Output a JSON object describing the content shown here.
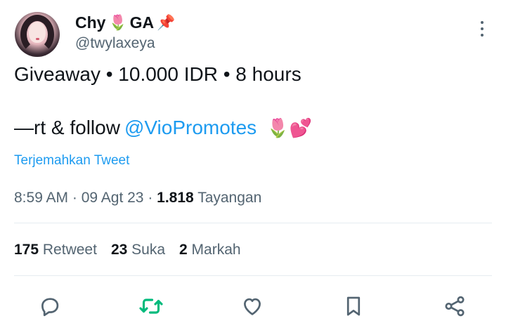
{
  "author": {
    "display_name": "Chy",
    "name_suffix": "GA",
    "emoji_1": "🌷",
    "emoji_2": "📌",
    "handle": "@twylaxeya"
  },
  "tweet": {
    "line1": "Giveaway • 10.000 IDR • 8 hours",
    "line2_prefix": "—rt & follow",
    "mention": "@VioPromotes",
    "line2_emoji": "🌷💕",
    "translate_link": "Terjemahkan Tweet"
  },
  "meta": {
    "time": "8:59 AM",
    "date": "09 Agt 23",
    "views_count": "1.818",
    "views_label": "Tayangan"
  },
  "stats": {
    "retweets_count": "175",
    "retweets_label": "Retweet",
    "likes_count": "23",
    "likes_label": "Suka",
    "bookmarks_count": "2",
    "bookmarks_label": "Markah"
  },
  "actions": {
    "reply_icon": "reply-icon",
    "retweet_icon": "retweet-icon",
    "like_icon": "heart-icon",
    "bookmark_icon": "bookmark-icon",
    "share_icon": "share-icon"
  },
  "colors": {
    "accent": "#1d9bf0",
    "retweet_green": "#00ba7c",
    "secondary_text": "#536471",
    "icon_gray": "#536471"
  }
}
